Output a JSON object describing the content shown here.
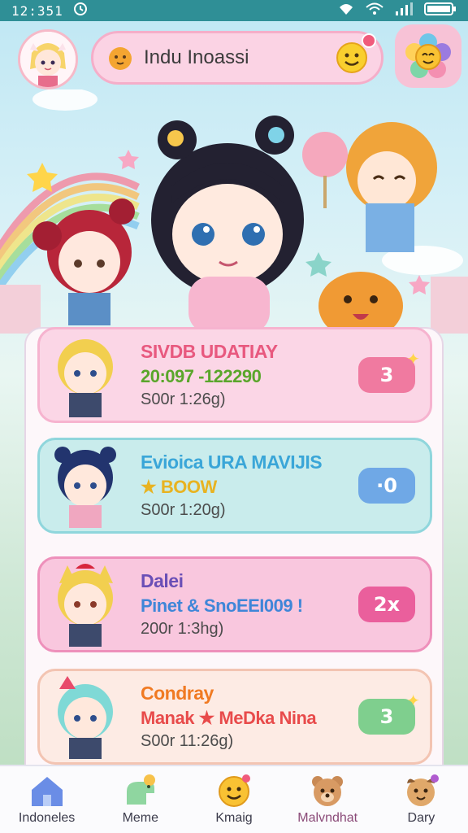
{
  "status_bar": {
    "time": "12:351",
    "icons": [
      "alarm-icon",
      "location-icon",
      "wifi-icon",
      "signal-icon",
      "battery-icon"
    ]
  },
  "header": {
    "search": {
      "text": "Indu Inoassi"
    }
  },
  "cards": [
    {
      "title": "SIVDB UDATIAY",
      "subtitle": "20:097 -122290",
      "time": "S00r 1:26g)",
      "badge": "3",
      "colors": {
        "bg": "#fbd6e6",
        "border": "#f6b3cf",
        "title": "#e8597f",
        "subtitle": "#5aa62b",
        "badge": "#f07aa0"
      }
    },
    {
      "title": "Evioica URA MAVIJIS",
      "subtitle": "★ BOOW",
      "time": "S00r 1:20g)",
      "badge": "·0",
      "colors": {
        "bg": "#c9ecec",
        "border": "#8fd6dc",
        "title": "#3aa6d8",
        "subtitle": "#e8b321",
        "badge": "#6fa8e6"
      }
    },
    {
      "title": "Dalei",
      "subtitle": "Pinet & SnoEEI009 !",
      "time": "200r 1:3hg)",
      "badge": "2x",
      "colors": {
        "bg": "#f9c7de",
        "border": "#ee90bb",
        "title": "#6a4fb6",
        "subtitle": "#3f86d8",
        "badge": "#ea5f9c"
      }
    },
    {
      "title": "Condray",
      "subtitle": "Manak ★ MeDka Nina",
      "time": "S00r 11:26g)",
      "badge": "3",
      "colors": {
        "bg": "#fdebe4",
        "border": "#f3c4b2",
        "title": "#f07a22",
        "subtitle": "#e84b4b",
        "badge": "#7fcf8e"
      }
    }
  ],
  "nav": [
    {
      "label": "Indoneles",
      "icon": "home-icon"
    },
    {
      "label": "Meme",
      "icon": "dino-icon"
    },
    {
      "label": "Kmaig",
      "icon": "smile-icon"
    },
    {
      "label": "Malvndhat",
      "icon": "bear-icon"
    },
    {
      "label": "Dary",
      "icon": "dog-icon"
    }
  ]
}
